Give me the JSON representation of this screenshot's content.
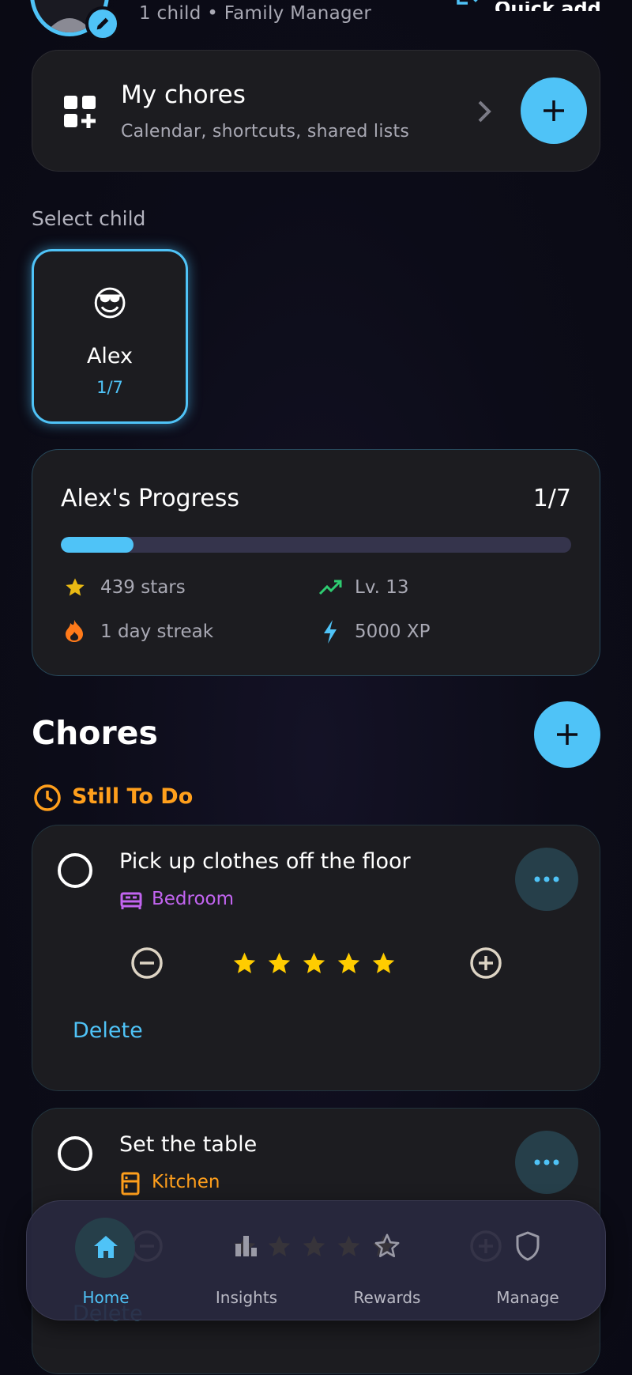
{
  "header": {
    "subtitle": "1 child • Family Manager",
    "quick_add_label": "Quick add"
  },
  "my_chores": {
    "title": "My chores",
    "subtitle": "Calendar, shortcuts, shared lists"
  },
  "select_child": {
    "label": "Select child",
    "children": [
      {
        "emoji": "😎",
        "name": "Alex",
        "progress": "1/7",
        "selected": true
      }
    ]
  },
  "progress_card": {
    "title": "Alex's Progress",
    "count": "1/7",
    "fraction": 0.1428,
    "stats": {
      "stars": "439 stars",
      "level": "Lv. 13",
      "streak": "1 day streak",
      "xp": "5000 XP"
    }
  },
  "chores": {
    "title": "Chores",
    "section_label": "Still To Do",
    "items": [
      {
        "title": "Pick up clothes off the floor",
        "room": "Bedroom",
        "room_color": "#c264f0",
        "stars": 5,
        "delete_label": "Delete"
      },
      {
        "title": "Set the table",
        "room": "Kitchen",
        "room_color": "#ff9f1c",
        "stars": 5,
        "delete_label": "Delete"
      }
    ]
  },
  "nav": {
    "items": [
      {
        "label": "Home",
        "active": true
      },
      {
        "label": "Insights",
        "active": false
      },
      {
        "label": "Rewards",
        "active": false
      },
      {
        "label": "Manage",
        "active": false
      }
    ]
  },
  "colors": {
    "accent": "#4fc3f7",
    "warning": "#ff9f1c",
    "star": "#ffcc00",
    "success": "#2ecc71"
  }
}
